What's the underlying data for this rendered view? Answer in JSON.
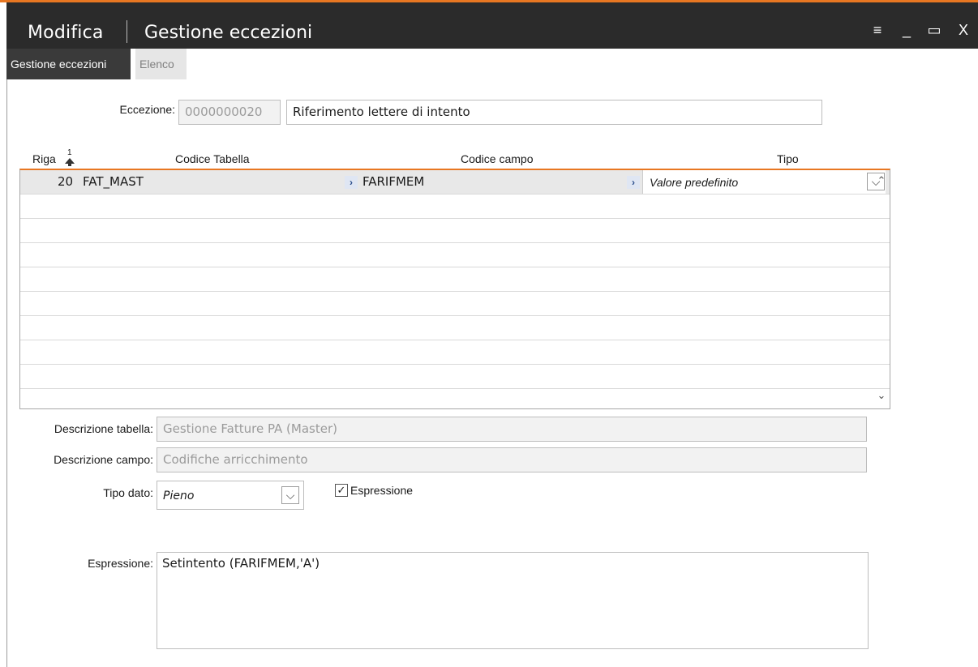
{
  "window": {
    "title": "Modifica",
    "subtitle": "Gestione eccezioni",
    "controls": {
      "menu": "≡",
      "minimize": "_",
      "maximize": "▭",
      "close": "X"
    },
    "accent_color": "#e87722"
  },
  "tabs": [
    {
      "label": "Gestione eccezioni",
      "active": true
    },
    {
      "label": "Elenco",
      "active": false
    }
  ],
  "eccezione": {
    "label": "Eccezione:",
    "code": "0000000020",
    "description": "Riferimento lettere di intento"
  },
  "grid": {
    "headers": {
      "riga": "Riga",
      "sort_marker": "1",
      "codice_tabella": "Codice Tabella",
      "codice_campo": "Codice campo",
      "tipo": "Tipo"
    },
    "rows": [
      {
        "riga": "20",
        "codice_tabella": "FAT_MAST",
        "codice_campo": "FARIFMEM",
        "tipo": "Valore predefinito"
      }
    ]
  },
  "details": {
    "descrizione_tabella_label": "Descrizione tabella:",
    "descrizione_tabella": "Gestione Fatture PA (Master)",
    "descrizione_campo_label": "Descrizione campo:",
    "descrizione_campo": "Codifiche arricchimento",
    "tipo_dato_label": "Tipo dato:",
    "tipo_dato": "Pieno",
    "espressione_checkbox_label": "Espressione",
    "espressione_checked": true,
    "espressione_label": "Espressione:",
    "espressione_value": "Setintento (FARIFMEM,'A')"
  }
}
